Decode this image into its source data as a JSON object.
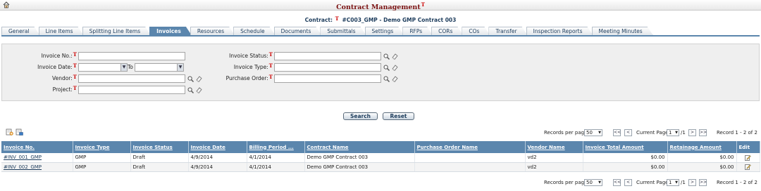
{
  "app": {
    "title": "Contract Management",
    "title_mark": "T"
  },
  "contract": {
    "label": "Contract:",
    "mark": "T",
    "value": "#C003_GMP - Demo GMP Contract 003"
  },
  "tabs": [
    {
      "label": "General"
    },
    {
      "label": "Line Items"
    },
    {
      "label": "Splitting Line Items"
    },
    {
      "label": "Invoices",
      "active": true
    },
    {
      "label": "Resources"
    },
    {
      "label": "Schedule"
    },
    {
      "label": "Documents"
    },
    {
      "label": "Submittals"
    },
    {
      "label": "Settings"
    },
    {
      "label": "RFPs"
    },
    {
      "label": "CORs"
    },
    {
      "label": "COs"
    },
    {
      "label": "Transfer"
    },
    {
      "label": "Inspection Reports"
    },
    {
      "label": "Meeting Minutes"
    }
  ],
  "search": {
    "invoice_no_label": "Invoice No.:",
    "invoice_date_label": "Invoice Date:",
    "to_label": "To",
    "vendor_label": "Vendor:",
    "project_label": "Project:",
    "invoice_status_label": "Invoice Status:",
    "invoice_type_label": "Invoice Type:",
    "purchase_order_label": "Purchase Order:",
    "mark": "T",
    "invoice_no_value": "",
    "invoice_date_from": "",
    "invoice_date_to": "",
    "vendor_value": "",
    "project_value": "",
    "invoice_status_value": "",
    "invoice_type_value": "",
    "purchase_order_value": "",
    "search_button": "Search",
    "reset_button": "Reset"
  },
  "pager_top": {
    "records_per_page_label": "Records per page",
    "records_per_page": "50",
    "first": "<<",
    "prev": "<",
    "current_page_label": "Current Page",
    "current_page": "1",
    "total_pages": "/1",
    "next": ">",
    "last": ">>",
    "record_summary": "Record 1 - 2 of 2"
  },
  "pager_bottom": {
    "records_per_page_label": "Records per page",
    "records_per_page": "50",
    "first": "<<",
    "prev": "<",
    "current_page_label": "Current Page",
    "current_page": "1",
    "total_pages": "/1",
    "next": ">",
    "last": ">>",
    "record_summary": "Record 1 - 2 of 2"
  },
  "table": {
    "columns": [
      "Invoice No.",
      "Invoice Type",
      "Invoice Status",
      "Invoice Date",
      "Billing Period ...",
      "Contract Name",
      "Purchase Order Name",
      "Vendor Name",
      "Invoice Total Amount",
      "Retainage Amount",
      "Edit"
    ],
    "rows": [
      [
        "#INV_001_GMP",
        "GMP",
        "Draft",
        "4/9/2014",
        "4/1/2014",
        "Demo GMP Contract 003",
        "",
        "vd2",
        "$0.00",
        "$0.00"
      ],
      [
        "#INV_002_GMP",
        "GMP",
        "Draft",
        "4/9/2014",
        "4/1/2014",
        "Demo GMP Contract 003",
        "",
        "vd2",
        "$0.00",
        "$0.00"
      ]
    ]
  },
  "colors": {
    "accent": "#5b86ad",
    "title": "#7a1212",
    "required_mark": "#cc0000"
  },
  "icons": [
    "home-icon",
    "magnifier-icon",
    "eraser-icon",
    "add-invoice-icon",
    "import-invoice-icon",
    "edit-icon"
  ]
}
